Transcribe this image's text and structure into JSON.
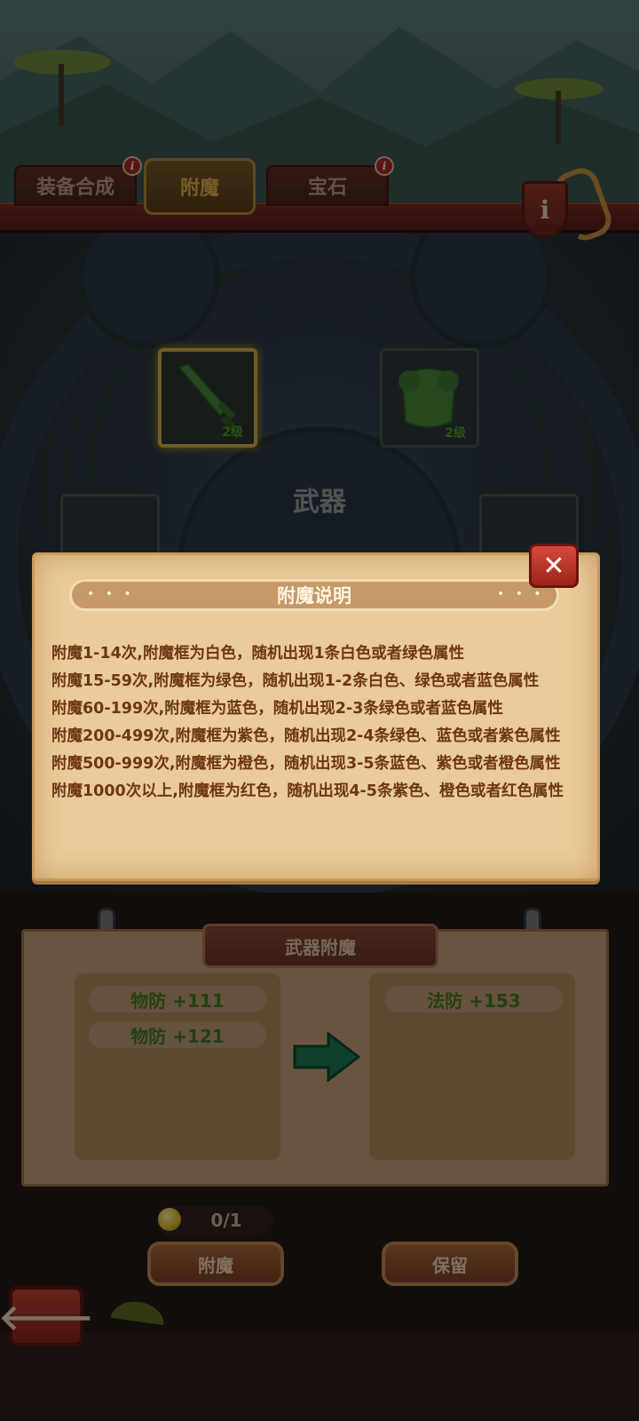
{
  "tabs": [
    {
      "label": "装备合成",
      "active": false,
      "badge": "i"
    },
    {
      "label": "附魔",
      "active": true,
      "badge": ""
    },
    {
      "label": "宝石",
      "active": false,
      "badge": "i"
    }
  ],
  "info_button": {
    "label": "i"
  },
  "arena": {
    "center_label": "武器",
    "slots": [
      {
        "name": "sword",
        "level": "2级",
        "selected": true
      },
      {
        "name": "armor",
        "level": "2级",
        "selected": false
      }
    ]
  },
  "dialog": {
    "title": "附魔说明",
    "close_label": "✕",
    "rules": [
      "附魔1-14次,附魔框为白色，随机出现1条白色或者绿色属性",
      "附魔15-59次,附魔框为绿色，随机出现1-2条白色、绿色或者蓝色属性",
      "附魔60-199次,附魔框为蓝色，随机出现2-3条绿色或者蓝色属性",
      "附魔200-499次,附魔框为紫色，随机出现2-4条绿色、蓝色或者紫色属性",
      "附魔500-999次,附魔框为橙色，随机出现3-5条蓝色、紫色或者橙色属性",
      "附魔1000次以上,附魔框为红色，随机出现4-5条紫色、橙色或者红色属性"
    ]
  },
  "enchant_panel": {
    "title": "武器附魔",
    "current_attrs": [
      "物防 +111",
      "物防 +121"
    ],
    "new_attrs": [
      "法防 +153"
    ],
    "cost": "0/1",
    "enchant_button": "附魔",
    "keep_button": "保留",
    "back_label": "🡐"
  },
  "colors": {
    "parchment": "#ebcb99",
    "rule_text": "#6d3715",
    "attr_text": "#437a2a",
    "tab_active": "#e2b34a"
  }
}
